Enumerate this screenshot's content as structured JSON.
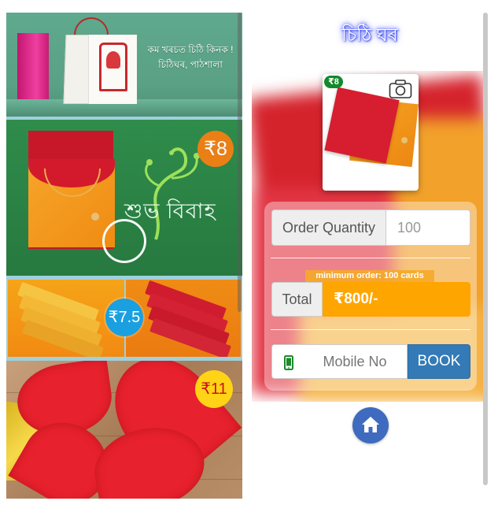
{
  "app": {
    "title": "চিঠি ঘৰ"
  },
  "catalog": {
    "banner1": {
      "line1": "কম খৰচত চিঠি কিনক !",
      "line2": "চিঠিঘৰ, পাঠশালা"
    },
    "banner2": {
      "price": "₹8",
      "title": "শুভ বিবাহ"
    },
    "banner3": {
      "price": "₹7.5"
    },
    "banner4": {
      "price": "₹11"
    }
  },
  "product": {
    "badge": "₹8",
    "icon": "camera-icon"
  },
  "order": {
    "quantity_label": "Order Quantity",
    "quantity_value": "100",
    "min_order_note": "minimum order: 100 cards",
    "total_label": "Total",
    "total_value": "₹800/-",
    "mobile_placeholder": "Mobile No",
    "phone_icon": "mobile-phone-icon",
    "book_label": "BOOK"
  },
  "nav": {
    "home_icon": "home-icon"
  },
  "colors": {
    "accent_orange": "#ffa500",
    "book_blue": "#337ab7",
    "badge_green": "#118a2c",
    "home_blue": "#3e6bbf"
  }
}
